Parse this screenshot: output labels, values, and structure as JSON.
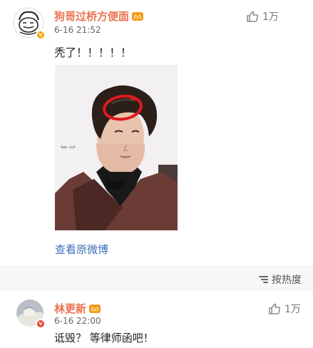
{
  "post": {
    "author": "狗哥过桥方便面",
    "timestamp": "6-16 21:52",
    "likes": "1万",
    "text": "秃了！！！！！",
    "view_original": "查看原微博",
    "photo_caption": "two cut"
  },
  "sort": {
    "label": "按热度"
  },
  "comment": {
    "author": "林更新",
    "timestamp": "6-16 22:00",
    "likes": "1万",
    "text": "诋毁？ 等律师函吧！"
  },
  "badge": {
    "verified": "v"
  },
  "colors": {
    "name": "#eb7350",
    "link": "#3b6fb6",
    "verified_badge": "#f7a600",
    "sortbar_bg": "#f7f7f7"
  }
}
